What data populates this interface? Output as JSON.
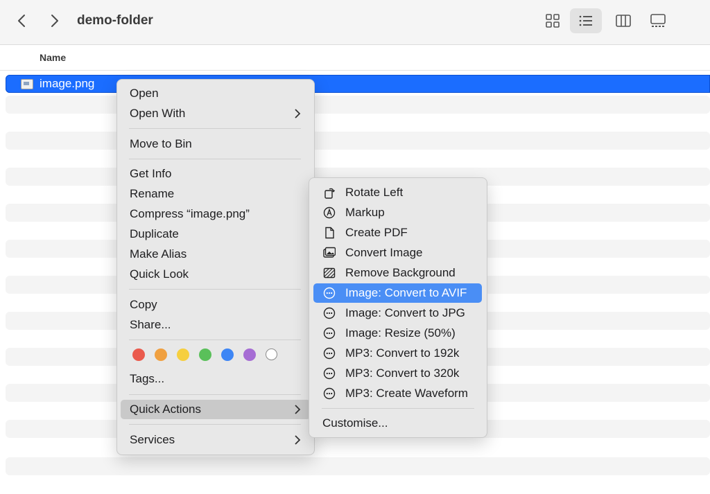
{
  "toolbar": {
    "title": "demo-folder",
    "back_icon": "chevron-left-icon",
    "forward_icon": "chevron-right-icon",
    "views": [
      "icon-view",
      "list-view",
      "column-view",
      "gallery-view"
    ],
    "active_view": "list-view"
  },
  "columns": {
    "name": "Name"
  },
  "file": {
    "name": "image.png",
    "icon": "image-file-icon"
  },
  "colors": {
    "selection": "#1b6dff",
    "submenu_selected": "#4a8ef5",
    "tags": [
      "#ea5a4d",
      "#f0a040",
      "#f6cf3f",
      "#5ac05a",
      "#3e86f5",
      "#a66dd4",
      "#ffffff"
    ]
  },
  "context_menu": {
    "open": "Open",
    "open_with": "Open With",
    "move_to_bin": "Move to Bin",
    "get_info": "Get Info",
    "rename": "Rename",
    "compress": "Compress “image.png”",
    "duplicate": "Duplicate",
    "make_alias": "Make Alias",
    "quick_look": "Quick Look",
    "copy": "Copy",
    "share": "Share...",
    "tags": "Tags...",
    "quick_actions": "Quick Actions",
    "services": "Services"
  },
  "quick_actions": {
    "items": [
      {
        "label": "Rotate Left",
        "icon": "rotate-left-icon"
      },
      {
        "label": "Markup",
        "icon": "markup-icon"
      },
      {
        "label": "Create PDF",
        "icon": "document-icon"
      },
      {
        "label": "Convert Image",
        "icon": "photos-icon"
      },
      {
        "label": "Remove Background",
        "icon": "remove-background-icon"
      },
      {
        "label": "Image: Convert to AVIF",
        "icon": "workflow-icon"
      },
      {
        "label": "Image: Convert to JPG",
        "icon": "workflow-icon"
      },
      {
        "label": "Image: Resize (50%)",
        "icon": "workflow-icon"
      },
      {
        "label": "MP3: Convert to 192k",
        "icon": "workflow-icon"
      },
      {
        "label": "MP3: Convert to 320k",
        "icon": "workflow-icon"
      },
      {
        "label": "MP3: Create Waveform",
        "icon": "workflow-icon"
      }
    ],
    "selected_index": 5,
    "customise": "Customise..."
  }
}
